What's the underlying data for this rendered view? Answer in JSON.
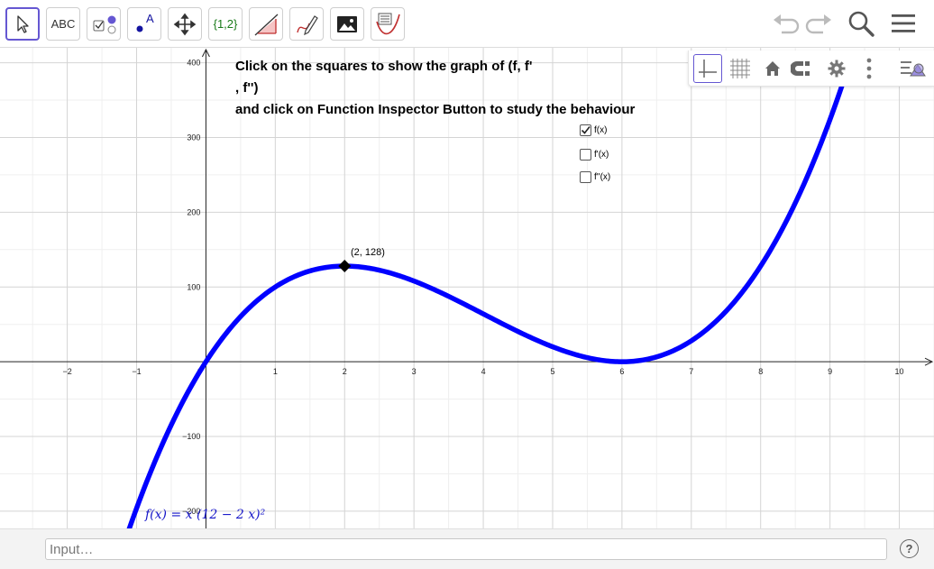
{
  "toolbar": {
    "tools": [
      {
        "name": "move",
        "label": ""
      },
      {
        "name": "text",
        "label": "ABC"
      },
      {
        "name": "checkbox",
        "label": ""
      },
      {
        "name": "point",
        "label": "A"
      },
      {
        "name": "move-graphics-view",
        "label": ""
      },
      {
        "name": "list",
        "label": "{1,2}"
      },
      {
        "name": "slope",
        "label": ""
      },
      {
        "name": "pen",
        "label": ""
      },
      {
        "name": "image",
        "label": ""
      },
      {
        "name": "function-inspector",
        "label": ""
      }
    ],
    "right_icons": [
      "undo-icon",
      "redo-icon",
      "search-icon",
      "menu-icon"
    ]
  },
  "graphics": {
    "instructions": [
      "Click on the squares to show the graph of (f, f'",
      ", f'')",
      "and click on Function Inspector Button to study the behaviour"
    ],
    "checkboxes": [
      {
        "label": "f(x)",
        "checked": true
      },
      {
        "label": "f'(x)",
        "checked": false
      },
      {
        "label": "f''(x)",
        "checked": false
      }
    ],
    "point": {
      "label": "(2, 128)",
      "x": 2,
      "y": 128
    },
    "function_label": "f(x)  = x (12 − 2 x)²",
    "stylebar_icons": [
      "axes-icon",
      "grid-icon",
      "home-icon",
      "snap-icon",
      "gear-icon",
      "more-icon",
      "stylebar-toggle-icon"
    ]
  },
  "chart_data": {
    "type": "line",
    "function": "x(12-2x)^2",
    "series": [
      {
        "name": "f(x)",
        "x": [
          -1,
          -0.5,
          0,
          0.5,
          1,
          1.5,
          2,
          2.5,
          3,
          3.5,
          4,
          4.5,
          5,
          5.5,
          6,
          6.5,
          7,
          7.5,
          8,
          8.5,
          9,
          9.2
        ],
        "y": [
          -196,
          -84.5,
          0,
          60.5,
          100,
          121.5,
          128,
          122.5,
          108,
          87.5,
          64,
          40.5,
          20,
          5.5,
          0,
          6.5,
          28,
          67.5,
          128,
          212.5,
          324,
          374.1
        ],
        "color": "#0000ff"
      }
    ],
    "xlim": [
      -2.97,
      10.5
    ],
    "ylim": [
      -223,
      420
    ],
    "x_ticks": [
      -2,
      -1,
      0,
      1,
      2,
      3,
      4,
      5,
      6,
      7,
      8,
      9,
      10
    ],
    "x_tick_labels": [
      "−2",
      "−1",
      "0",
      "1",
      "2",
      "3",
      "4",
      "5",
      "6",
      "7",
      "8",
      "9",
      "10"
    ],
    "y_ticks": [
      -100,
      100,
      200,
      300,
      400
    ],
    "y_tick_labels": [
      "−100",
      "100",
      "200",
      "300",
      "400"
    ],
    "y_tick_extra": [
      "−200"
    ],
    "grid": true
  },
  "input": {
    "placeholder": "Input…"
  },
  "help_label": "?"
}
